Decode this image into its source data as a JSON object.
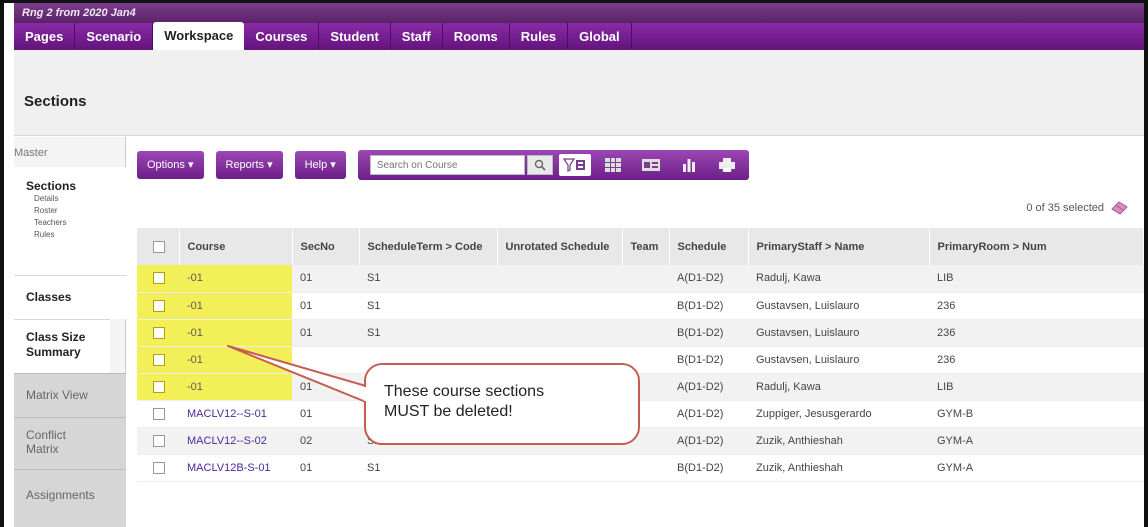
{
  "window_title": "Rng 2 from 2020 Jan4",
  "nav": {
    "tabs": [
      "Pages",
      "Scenario",
      "Workspace",
      "Courses",
      "Student",
      "Staff",
      "Rooms",
      "Rules",
      "Global"
    ],
    "active": "Workspace"
  },
  "page_title": "Sections",
  "sidebar": {
    "master_label": "Master",
    "sections_label": "Sections",
    "sections_subitems": [
      "Details",
      "Roster",
      "Teachers",
      "Rules"
    ],
    "items": [
      "Classes",
      "Class Size Summary",
      "Matrix View",
      "Conflict Matrix",
      "Assignments"
    ]
  },
  "toolbar": {
    "options_label": "Options ▾",
    "reports_label": "Reports ▾",
    "help_label": "Help ▾",
    "search_placeholder": "Search on Course"
  },
  "selection": {
    "text": "0 of 35 selected"
  },
  "table": {
    "columns": [
      "",
      "Course",
      "SecNo",
      "ScheduleTerm > Code",
      "Unrotated Schedule",
      "Team",
      "Schedule",
      "PrimaryStaff > Name",
      "PrimaryRoom > Num"
    ],
    "rows": [
      {
        "course": "-01",
        "secno": "01",
        "term": "S1",
        "unrotated": "",
        "team": "",
        "schedule": "A(D1-D2)",
        "staff": "Radulj, Kawa",
        "room": "LIB"
      },
      {
        "course": "-01",
        "secno": "01",
        "term": "S1",
        "unrotated": "",
        "team": "",
        "schedule": "B(D1-D2)",
        "staff": "Gustavsen, Luislauro",
        "room": "236"
      },
      {
        "course": "-01",
        "secno": "01",
        "term": "S1",
        "unrotated": "",
        "team": "",
        "schedule": "B(D1-D2)",
        "staff": "Gustavsen, Luislauro",
        "room": "236"
      },
      {
        "course": "-01",
        "secno": "",
        "term": "",
        "unrotated": "",
        "team": "",
        "schedule": "B(D1-D2)",
        "staff": "Gustavsen, Luislauro",
        "room": "236"
      },
      {
        "course": "-01",
        "secno": "01",
        "term": "",
        "unrotated": "",
        "team": "",
        "schedule": "A(D1-D2)",
        "staff": "Radulj, Kawa",
        "room": "LIB"
      },
      {
        "course": "MACLV12--S-01",
        "secno": "01",
        "term": "",
        "unrotated": "",
        "team": "",
        "schedule": "A(D1-D2)",
        "staff": "Zuppiger, Jesusgerardo",
        "room": "GYM-B"
      },
      {
        "course": "MACLV12--S-02",
        "secno": "02",
        "term": "S2",
        "unrotated": "",
        "team": "",
        "schedule": "A(D1-D2)",
        "staff": "Zuzik, Anthieshah",
        "room": "GYM-A"
      },
      {
        "course": "MACLV12B-S-01",
        "secno": "01",
        "term": "S1",
        "unrotated": "",
        "team": "",
        "schedule": "B(D1-D2)",
        "staff": "Zuzik, Anthieshah",
        "room": "GYM-A"
      }
    ]
  },
  "callout": {
    "line1": "These course sections",
    "line2": "MUST be deleted!"
  },
  "colors": {
    "brand_purple": "#6d1e88",
    "highlight_yellow": "#f3ef58",
    "callout_border": "#c45d52",
    "schedule_red": "#c0392b"
  }
}
